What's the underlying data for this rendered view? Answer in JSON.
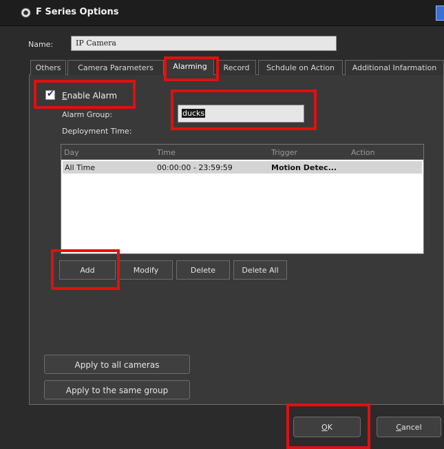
{
  "window": {
    "title": "F Series Options"
  },
  "name": {
    "label": "Name:",
    "value": "IP Camera"
  },
  "tabs": [
    {
      "label": "Others"
    },
    {
      "label": "Camera Parameters"
    },
    {
      "label": "Alarming"
    },
    {
      "label": "Record"
    },
    {
      "label": "Schdule on Action"
    },
    {
      "label": "Additional Infarmation"
    }
  ],
  "alarm": {
    "enable_label_accel": "E",
    "enable_label_rest": "nable Alarm",
    "enabled": true,
    "group_label": "Alarm Group:",
    "group_value": "ducks",
    "deployment_label": "Deployment Time:"
  },
  "table": {
    "columns": [
      "Day",
      "Time",
      "Trigger",
      "Action"
    ],
    "rows": [
      {
        "day": "All Time",
        "time": "00:00:00 - 23:59:59",
        "trigger": "Motion Detec...",
        "action": ""
      }
    ]
  },
  "buttons": {
    "add": "Add",
    "modify": "Modify",
    "delete": "Delete",
    "delete_all": "Delete All",
    "apply_all": "Apply to all cameras",
    "apply_group": "Apply to the same group",
    "ok_accel": "O",
    "ok_rest": "K",
    "cancel_accel": "C",
    "cancel_rest": "ancel"
  },
  "colors": {
    "highlight": "#e01010",
    "background": "#2b2b2b",
    "title_bar": "#1d1d1d"
  }
}
